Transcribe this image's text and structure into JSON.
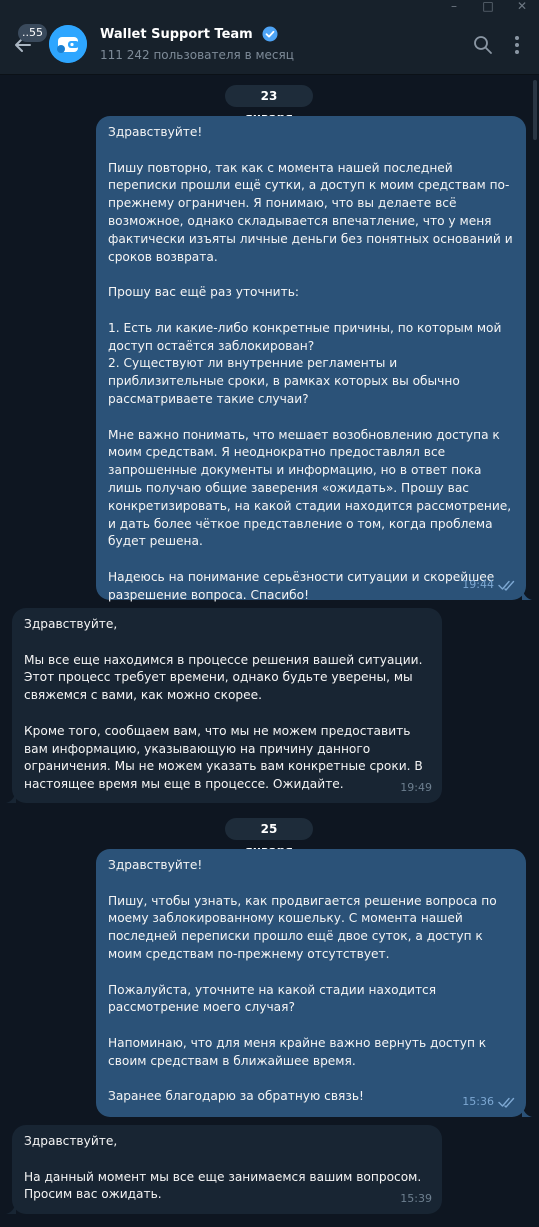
{
  "header": {
    "unread_badge": "..55",
    "title": "Wallet Support Team",
    "subtitle": "111 242 пользователя в месяц"
  },
  "dates": [
    "23 января",
    "25 января"
  ],
  "messages": [
    {
      "direction": "out",
      "text": "Здравствуйте!\n\nПишу повторно, так как с момента нашей последней переписки прошли ещё сутки, а доступ к моим средствам по-прежнему ограничен. Я понимаю, что вы делаете всё возможное, однако складывается впечатление, что у меня фактически изъяты личные деньги без понятных оснований и сроков возврата.\n\nПрошу вас ещё раз уточнить:\n\n1. Есть ли какие-либо конкретные причины, по которым мой доступ остаётся заблокирован?\n2. Существуют ли внутренние регламенты и приблизительные сроки, в рамках которых вы обычно рассматриваете такие случаи?\n\nМне важно понимать, что мешает возобновлению доступа к моим средствам. Я неоднократно предоставлял все запрошенные документы и информацию, но в ответ пока лишь получаю общие заверения «ожидать». Прошу вас конкретизировать, на какой стадии находится рассмотрение, и дать более чёткое представление о том, когда проблема будет решена.\n\nНадеюсь на понимание серьёзности ситуации и скорейшее разрешение вопроса. Спасибо!",
      "time": "19:44"
    },
    {
      "direction": "in",
      "text": "Здравствуйте,\n\nМы все еще находимся в процессе решения вашей ситуации. Этот процесс требует времени, однако будьте уверены, мы свяжемся с вами, как можно скорее.\n\nКроме того, сообщаем вам, что мы не можем предоставить вам информацию, указывающую на причину данного ограничения. Мы не можем указать вам конкретные сроки. В настоящее время мы еще в процессе. Ожидайте.",
      "time": "19:49"
    },
    {
      "direction": "out",
      "text": "Здравствуйте!\n\nПишу, чтобы узнать, как продвигается решение вопроса по моему заблокированному кошельку. С момента нашей последней переписки прошло ещё двое суток, а доступ к моим средствам по-прежнему отсутствует.\n\nПожалуйста, уточните на какой стадии находится рассмотрение моего случая?\n\nНапоминаю, что для меня крайне важно вернуть доступ к своим средствам в ближайшее время.\n\nЗаранее благодарю за обратную связь!",
      "time": "15:36"
    },
    {
      "direction": "in",
      "text": "Здравствуйте,\n\nНа данный момент мы все еще занимаемся вашим вопросом.\nПросим вас ожидать.",
      "time": "15:39"
    }
  ],
  "colors": {
    "background": "#0e1621",
    "header": "#17212b",
    "outgoing_bubble": "#2b5278",
    "incoming_bubble": "#182533",
    "accent": "#2ea6ff"
  }
}
